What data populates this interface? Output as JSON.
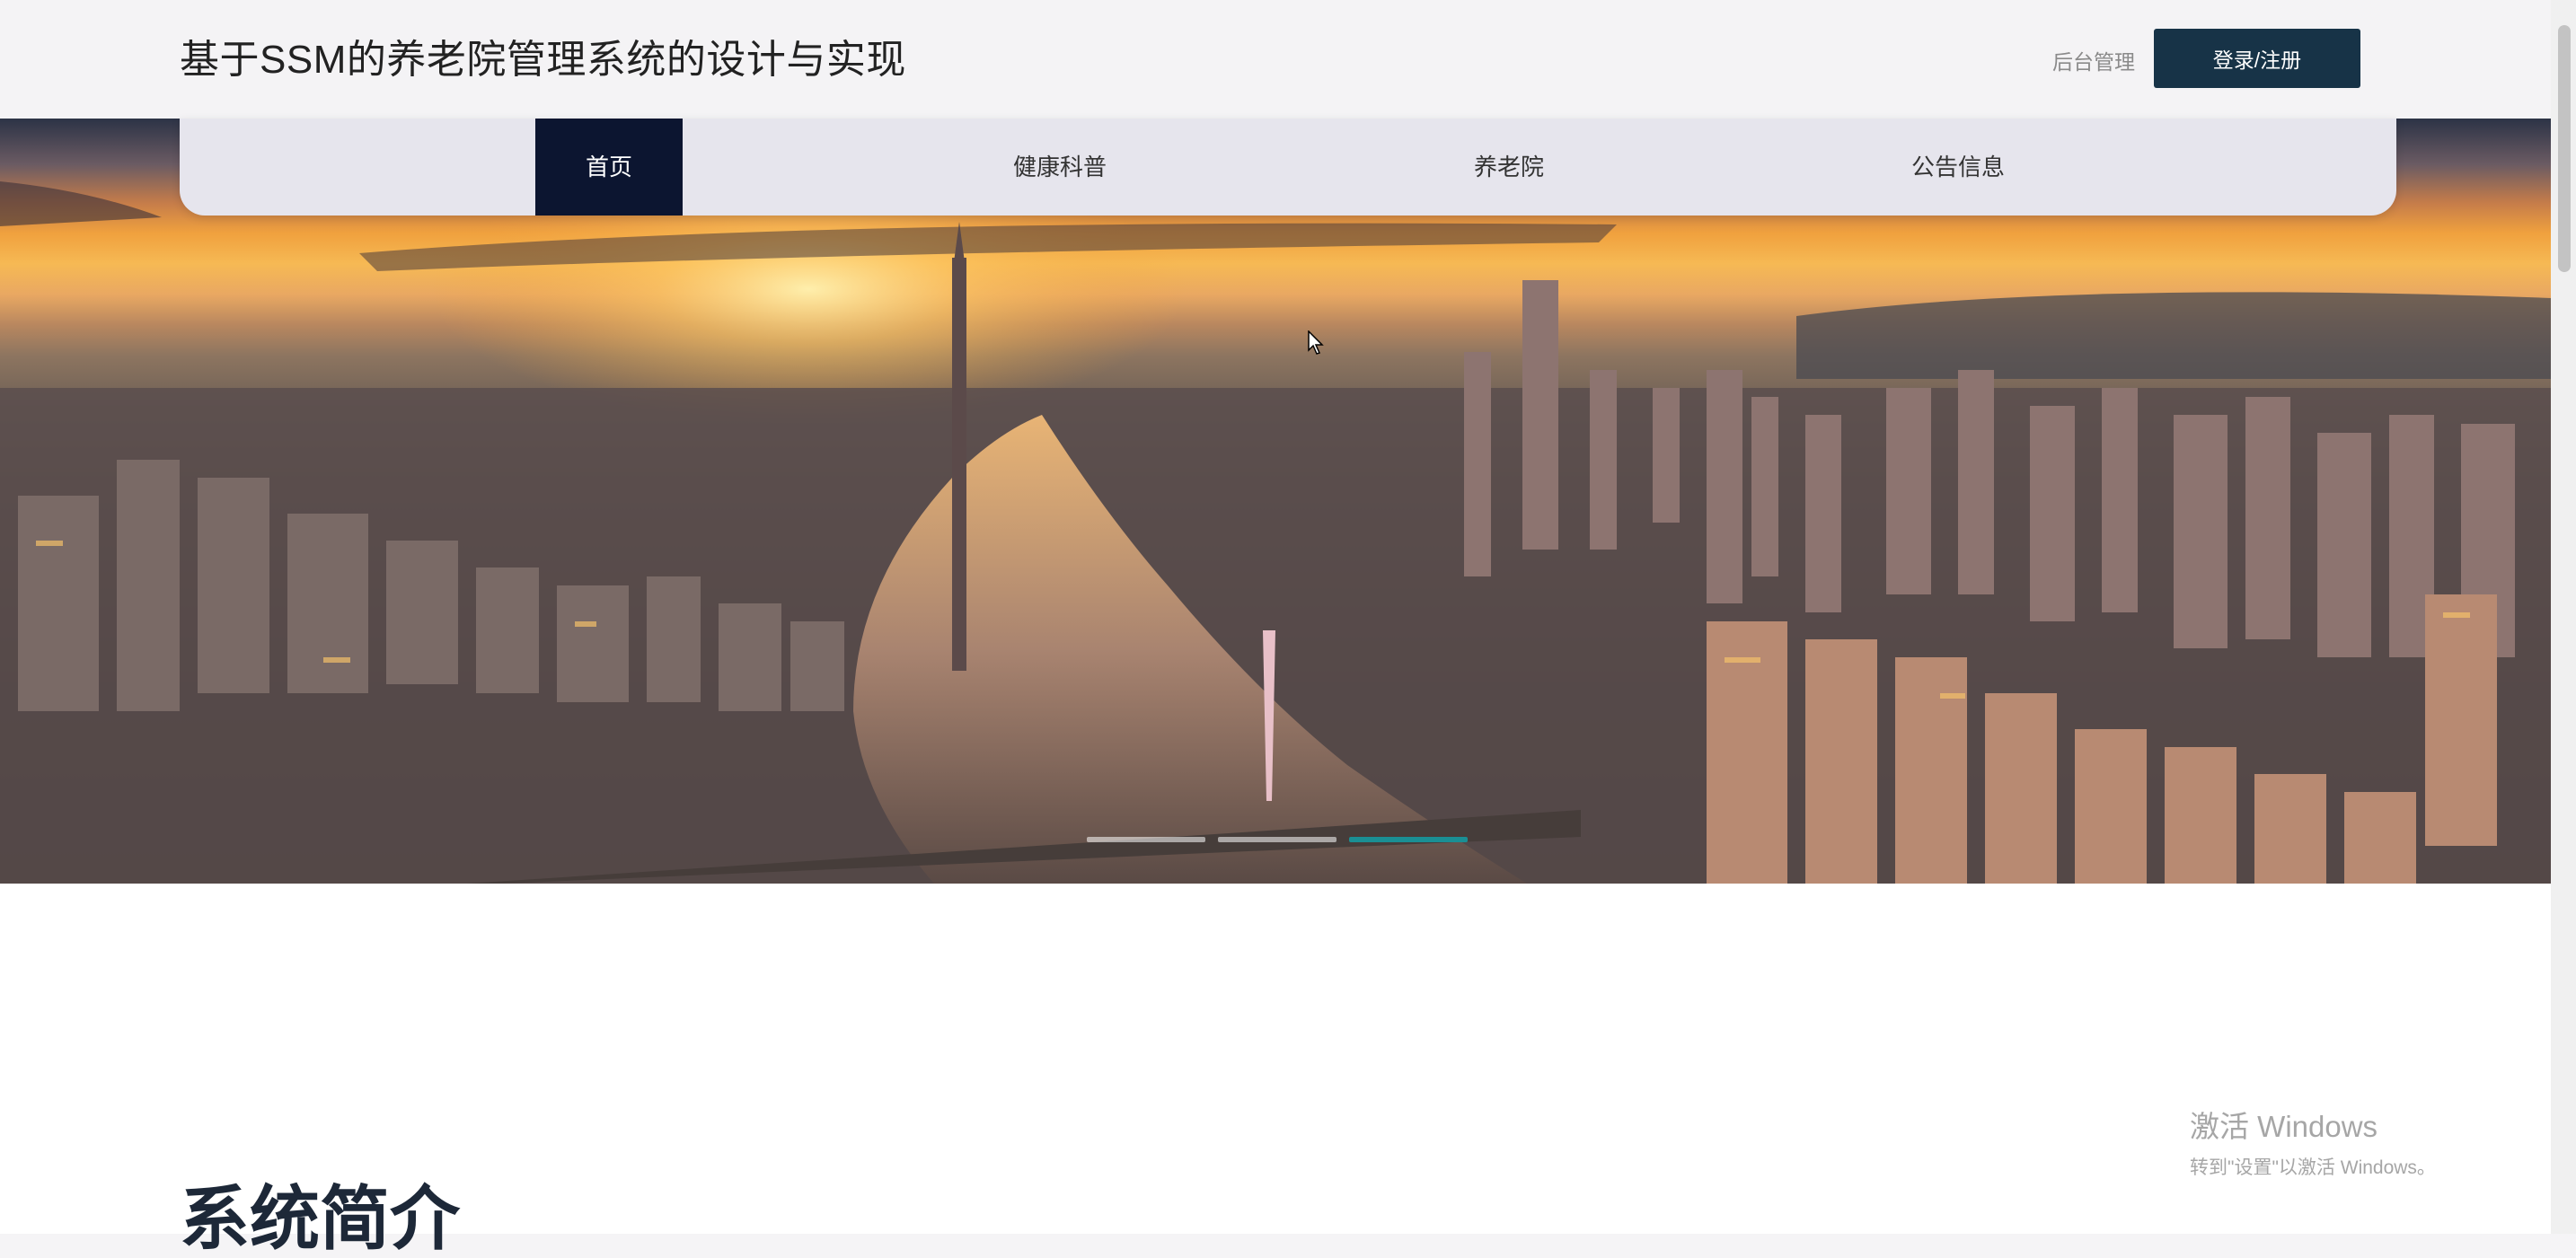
{
  "header": {
    "title": "基于SSM的养老院管理系统的设计与实现",
    "admin_link": "后台管理",
    "login_button": "登录/注册"
  },
  "nav": {
    "items": [
      {
        "label": "首页",
        "active": true
      },
      {
        "label": "健康科普",
        "active": false
      },
      {
        "label": "养老院",
        "active": false
      },
      {
        "label": "公告信息",
        "active": false
      }
    ]
  },
  "carousel": {
    "slide_count": 3,
    "active_index": 2,
    "active_color": "#1a8f94"
  },
  "main": {
    "section_title": "系统简介"
  },
  "watermark": {
    "line1": "激活 Windows",
    "line2": "转到\"设置\"以激活 Windows。"
  },
  "colors": {
    "login_button_bg": "#173347",
    "nav_active_bg": "#0c1530",
    "nav_bg": "#e6e5ed"
  }
}
